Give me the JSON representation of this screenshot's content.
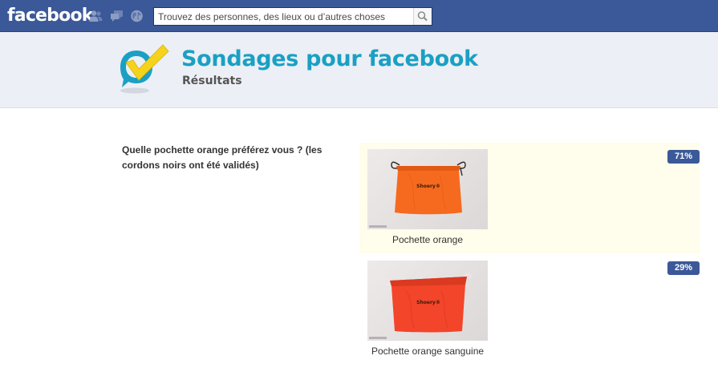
{
  "header": {
    "logo_text": "facebook",
    "icons": [
      "friend-requests-icon",
      "messages-icon",
      "notifications-icon",
      "search-icon"
    ],
    "search": {
      "placeholder": "Trouvez des personnes, des lieux ou d’autres choses",
      "value": ""
    }
  },
  "app": {
    "logo_icon": "speech-bubble-checkmark-icon",
    "title": "Sondages pour facebook",
    "subtitle": "Résultats"
  },
  "poll": {
    "question": "Quelle pochette orange préférez vous ? (les cordons noirs ont été validés)",
    "options": [
      {
        "label": "Pochette orange",
        "percent": "71%",
        "share": 0.71,
        "bag_color": "#f66a1f",
        "cord_color": "#2a2a2a",
        "highlighted": true
      },
      {
        "label": "Pochette orange sanguine",
        "percent": "29%",
        "share": 0.29,
        "bag_color": "#f2452a",
        "cord_color": "#f0e8e6",
        "highlighted": false
      }
    ],
    "bag_brand_text": "Shoery®"
  },
  "colors": {
    "facebook_blue": "#3b5998",
    "banner_bg": "#eceff5",
    "app_title_teal": "#1aa0c4",
    "winner_bg": "#fffdeb"
  }
}
